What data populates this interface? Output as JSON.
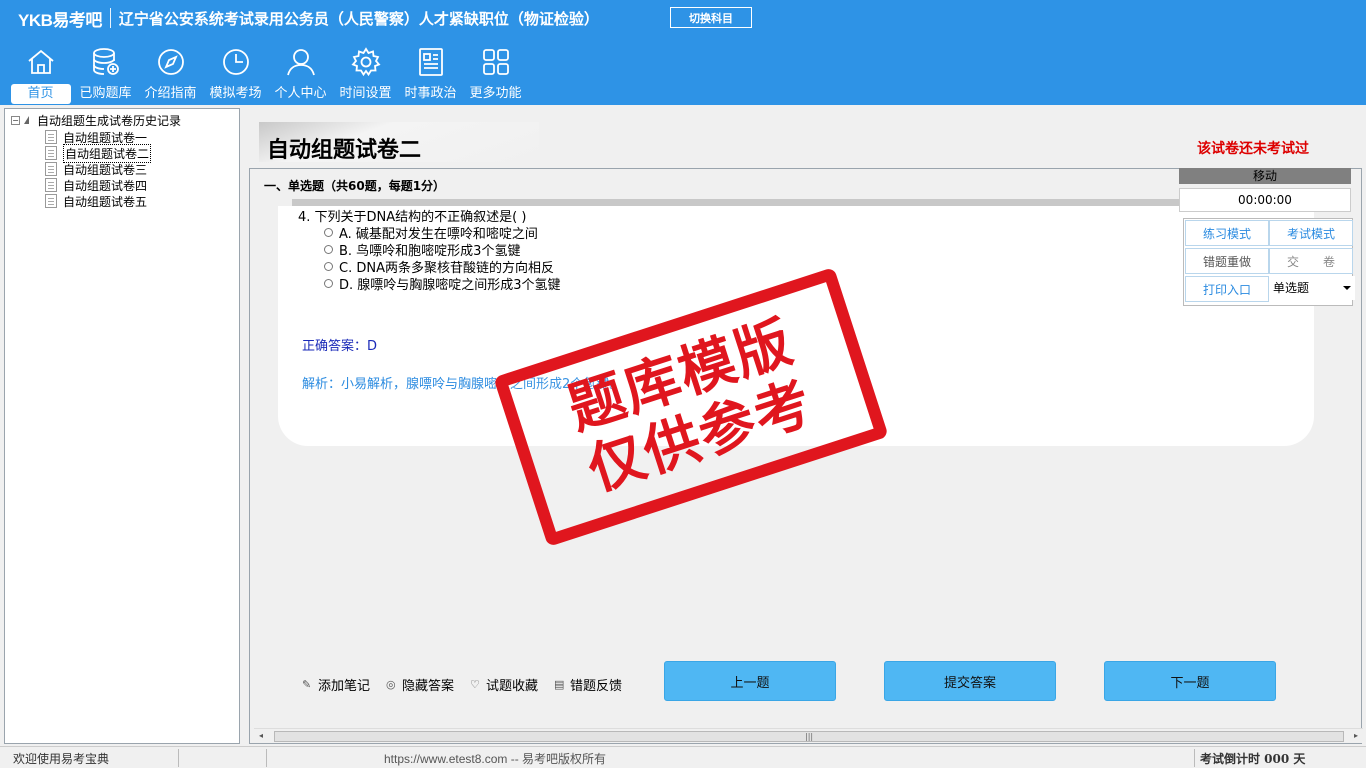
{
  "header": {
    "logo": "YKB易考吧",
    "exam_title": "辽宁省公安系统考试录用公务员（人民警察）人才紧缺职位（物证检验）",
    "switch_subject": "切换科目",
    "nav": [
      {
        "label": "首页",
        "icon": "home-icon"
      },
      {
        "label": "已购题库",
        "icon": "database-icon"
      },
      {
        "label": "介绍指南",
        "icon": "compass-icon"
      },
      {
        "label": "模拟考场",
        "icon": "clock-icon"
      },
      {
        "label": "个人中心",
        "icon": "user-icon"
      },
      {
        "label": "时间设置",
        "icon": "gear-icon"
      },
      {
        "label": "时事政治",
        "icon": "news-icon"
      },
      {
        "label": "更多功能",
        "icon": "grid-icon"
      }
    ]
  },
  "tree": {
    "root": "自动组题生成试卷历史记录",
    "children": [
      "自动组题试卷一",
      "自动组题试卷二",
      "自动组题试卷三",
      "自动组题试卷四",
      "自动组题试卷五"
    ]
  },
  "paper": {
    "title": "自动组题试卷二",
    "status": "该试卷还未考试过",
    "section": "一、单选题（共60题，每题1分）",
    "question": "4. 下列关于DNA结构的不正确叙述是( )",
    "options": [
      "A. 碱基配对发生在嘌呤和嘧啶之间",
      "B. 鸟嘌呤和胞嘧啶形成3个氢键",
      "C. DNA两条多聚核苷酸链的方向相反",
      "D. 腺嘌呤与胸腺嘧啶之间形成3个氢键"
    ],
    "answer": "正确答案：D",
    "analysis": "解析：小易解析，腺嘌呤与胸腺嘧啶之间形成2个氢键。"
  },
  "tools": [
    "添加笔记",
    "隐藏答案",
    "试题收藏",
    "错题反馈"
  ],
  "buttons": {
    "prev": "上一题",
    "submit": "提交答案",
    "next": "下一题"
  },
  "control": {
    "move": "移动",
    "timer": "00:00:00",
    "practice": "练习模式",
    "exam": "考试模式",
    "redo": "错题重做",
    "hand_in": "交　　卷",
    "print": "打印入口",
    "type": "单选题"
  },
  "stamp": {
    "line1": "题库模版",
    "line2": "仅供参考"
  },
  "status": {
    "welcome": "欢迎使用易考宝典",
    "url": "https://www.etest8.com -- 易考吧版权所有",
    "countdown": "考试倒计时 000 天"
  }
}
